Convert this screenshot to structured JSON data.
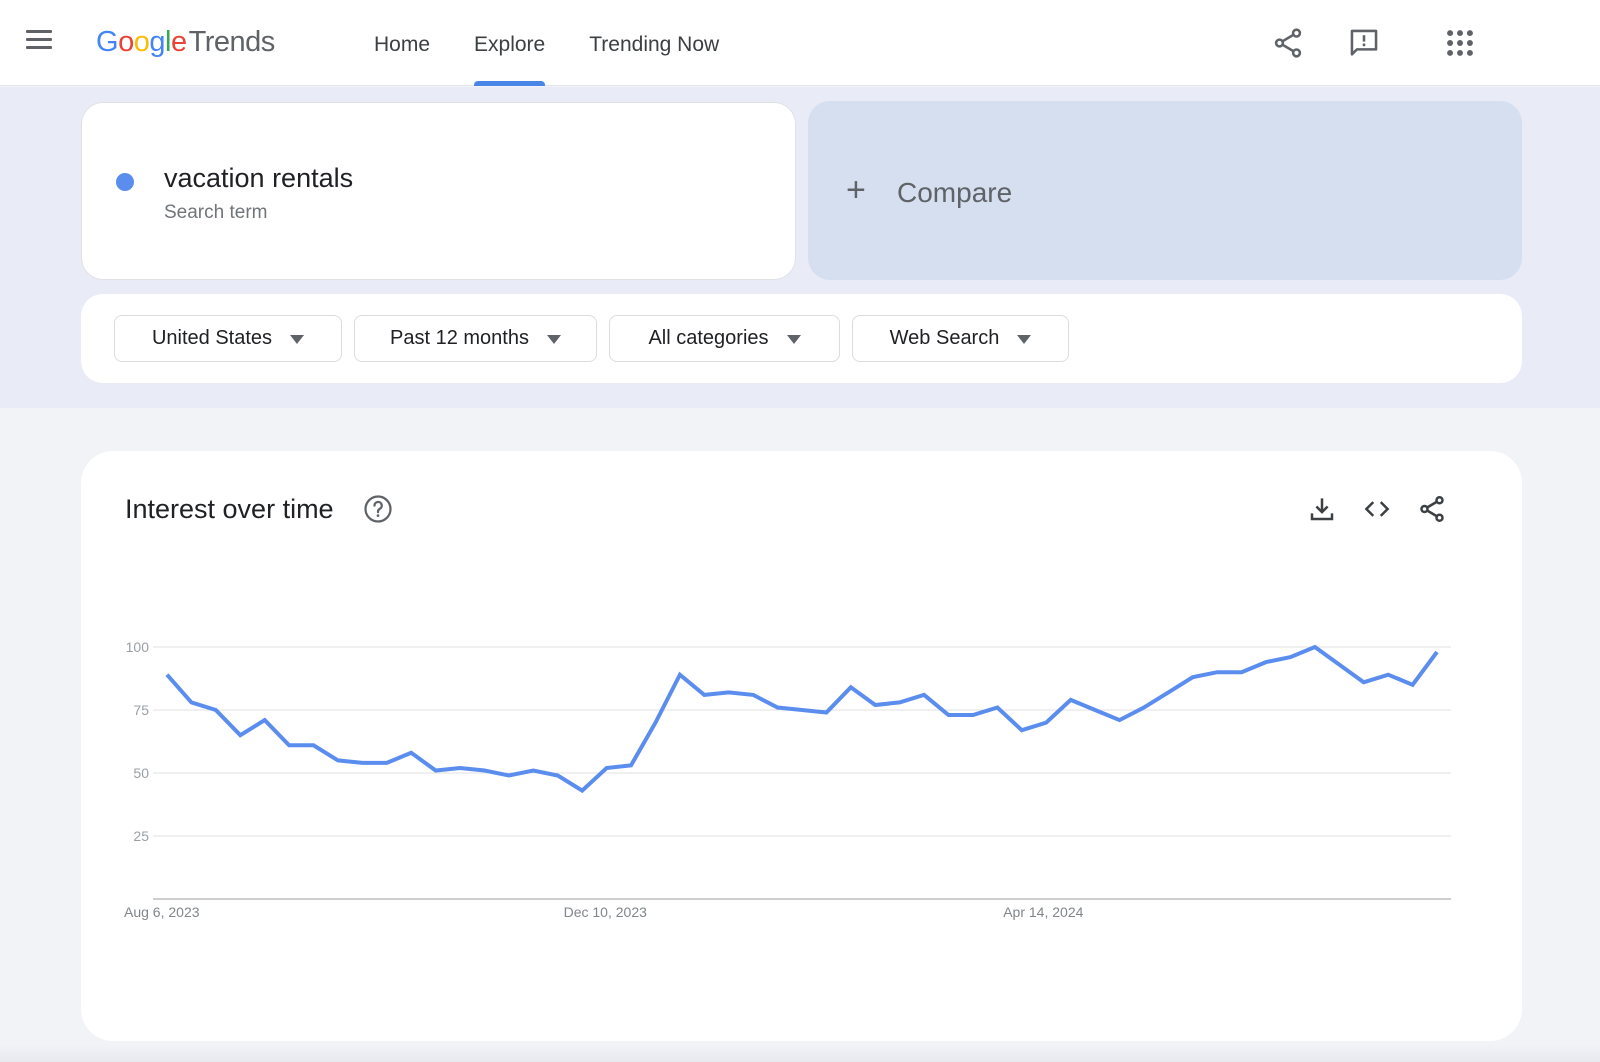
{
  "header": {
    "logo_google": [
      "G",
      "o",
      "o",
      "g",
      "l",
      "e"
    ],
    "logo_product": "Trends",
    "nav": [
      {
        "label": "Home",
        "active": false
      },
      {
        "label": "Explore",
        "active": true
      },
      {
        "label": "Trending Now",
        "active": false
      }
    ],
    "icons": [
      "menu-icon",
      "share-icon",
      "feedback-icon",
      "apps-grid-icon"
    ]
  },
  "search": {
    "term": "vacation rentals",
    "term_type": "Search term",
    "term_color": "#5b8def",
    "compare_label": "Compare",
    "compare_icon": "plus-icon"
  },
  "filters": [
    {
      "label": "United States"
    },
    {
      "label": "Past 12 months"
    },
    {
      "label": "All categories"
    },
    {
      "label": "Web Search"
    }
  ],
  "interest_card": {
    "title": "Interest over time",
    "icons": [
      "help-icon",
      "download-icon",
      "embed-code-icon",
      "share-icon"
    ]
  },
  "chart_data": {
    "type": "line",
    "title": "Interest over time",
    "xlabel": "",
    "ylabel": "",
    "ylim": [
      0,
      100
    ],
    "yticks": [
      25,
      50,
      75,
      100
    ],
    "grid": true,
    "x_tick_labels": [
      {
        "index": 0,
        "label": "Aug 6, 2023"
      },
      {
        "index": 18,
        "label": "Dec 10, 2023"
      },
      {
        "index": 36,
        "label": "Apr 14, 2024"
      }
    ],
    "series": [
      {
        "name": "vacation rentals",
        "color": "#5b8def",
        "values": [
          89,
          78,
          75,
          65,
          71,
          61,
          61,
          55,
          54,
          54,
          58,
          51,
          52,
          51,
          49,
          51,
          49,
          43,
          52,
          53,
          70,
          89,
          81,
          82,
          81,
          76,
          75,
          74,
          84,
          77,
          78,
          81,
          73,
          73,
          76,
          67,
          70,
          79,
          75,
          71,
          76,
          82,
          88,
          90,
          90,
          94,
          96,
          100,
          93,
          86,
          89,
          85,
          98
        ]
      }
    ]
  }
}
